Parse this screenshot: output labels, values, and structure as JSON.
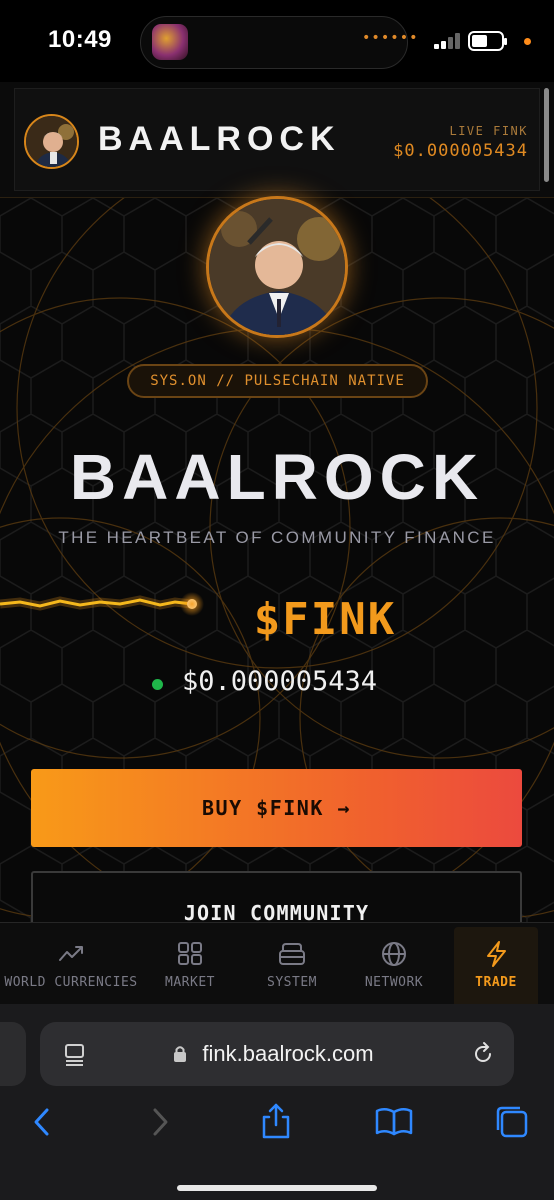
{
  "status_bar": {
    "time": "10:49",
    "activity_dots": "••••••"
  },
  "header": {
    "brand": "BAALROCK",
    "live_label": "LIVE FINK",
    "live_price": "$0.000005434"
  },
  "hero": {
    "chain_badge": "SYS.ON // PULSECHAIN NATIVE",
    "title": "BAALROCK",
    "tagline": "THE HEARTBEAT OF COMMUNITY FINANCE",
    "ticker": "$FINK",
    "price": "$0.000005434",
    "price_status": "live"
  },
  "actions": {
    "buy_label": "BUY $FINK →",
    "join_label": "JOIN COMMUNITY"
  },
  "app_nav": {
    "items": [
      {
        "label": "WORLD CURRENCIES",
        "icon": "trending-up-icon"
      },
      {
        "label": "MARKET",
        "icon": "grid-icon"
      },
      {
        "label": "SYSTEM",
        "icon": "stack-icon"
      },
      {
        "label": "NETWORK",
        "icon": "globe-icon"
      },
      {
        "label": "TRADE",
        "icon": "lightning-icon",
        "active": true
      }
    ]
  },
  "browser": {
    "url": "fink.baalrock.com"
  },
  "colors": {
    "accent": "#f39a1c",
    "accent_red": "#ec4a3e",
    "background": "#080808",
    "live_dot": "#1fb64a"
  }
}
